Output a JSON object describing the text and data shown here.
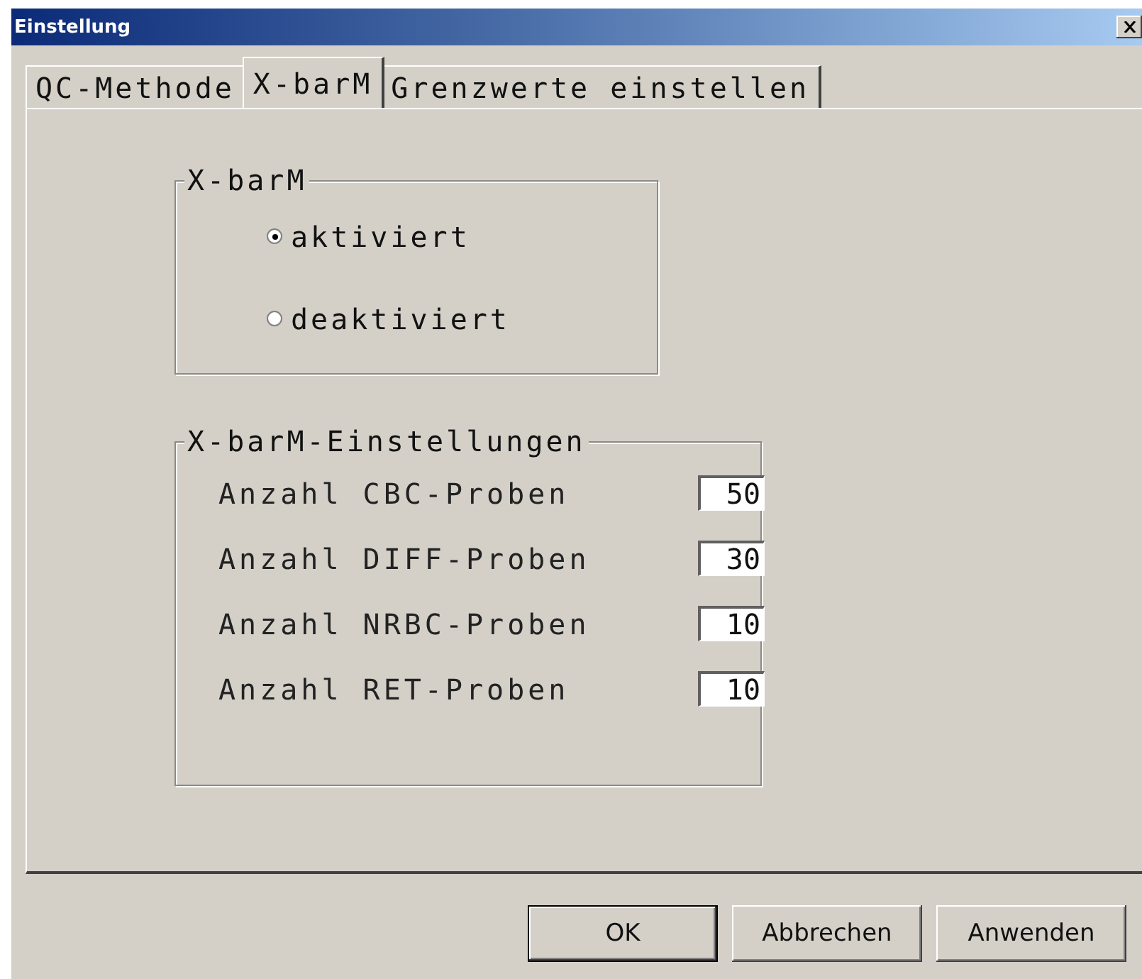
{
  "window": {
    "title": "Einstellung"
  },
  "tabs": [
    {
      "label": "QC-Methode",
      "selected": false
    },
    {
      "label": "X-barM",
      "selected": true
    },
    {
      "label": "Grenzwerte einstellen",
      "selected": false
    }
  ],
  "mode_group": {
    "title": "X-barM",
    "options": [
      {
        "label": "aktiviert",
        "selected": true
      },
      {
        "label": "deaktiviert",
        "selected": false
      }
    ]
  },
  "settings_group": {
    "title": "X-barM-Einstellungen",
    "fields": [
      {
        "label": "Anzahl CBC-Proben",
        "value": "50"
      },
      {
        "label": "Anzahl DIFF-Proben",
        "value": "30"
      },
      {
        "label": "Anzahl NRBC-Proben",
        "value": "10"
      },
      {
        "label": "Anzahl RET-Proben",
        "value": "10"
      }
    ]
  },
  "buttons": [
    {
      "label": "OK",
      "default": true
    },
    {
      "label": "Abbrechen",
      "default": false
    },
    {
      "label": "Anwenden",
      "default": false
    }
  ]
}
